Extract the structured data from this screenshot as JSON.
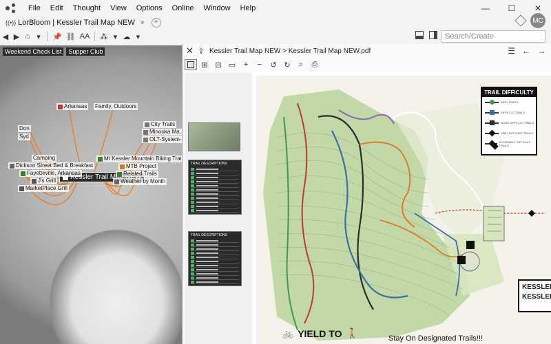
{
  "menu": {
    "items": [
      "File",
      "Edit",
      "Thought",
      "View",
      "Options",
      "Online",
      "Window",
      "Help"
    ]
  },
  "window_controls": {
    "minimize": "—",
    "maximize": "☐",
    "close": "✕"
  },
  "tab": {
    "title": "LorBloom | Kessler Trail Map NEW",
    "close": "×",
    "new_tab": "+"
  },
  "user": {
    "initials": "MC"
  },
  "toolbar": {
    "font_label": "AA"
  },
  "search": {
    "placeholder": "Search/Create"
  },
  "brain": {
    "quick_tabs": [
      "Weekend Check List",
      "Supper Club"
    ],
    "central": "Kessler Trail Map NEW",
    "thoughts": {
      "arkansas": "Arkansas",
      "family": "Family, Outdoors",
      "city_trails": "City Trails",
      "minooka": "Minooka Ma...",
      "olt": "OLT-System-...",
      "don": "Don",
      "syd": "Syd",
      "camping": "Camping",
      "dickson": "Dickson Street Bed & Breakfast",
      "fayetteville": "Fayetteville, Arkansas",
      "js_grill": "J's Grill",
      "marketplace": "MarketPlace Grill",
      "mt_kessler": "Mt Kessler Mountain Biking Trails",
      "mtb": "MTB Project",
      "related": "Related Trails",
      "weather": "Weather by Month"
    },
    "colors": {
      "link": "#f07a1e",
      "central_bg": "#2a2a2a"
    }
  },
  "document": {
    "breadcrumb": "Kessler Trail Map NEW > Kessler Trail Map NEW.pdf",
    "thumb_table_1_title": "TRAIL DESCRIPTIONS",
    "thumb_table_2_title": "TRAIL DESCRIPTIONS"
  },
  "map": {
    "legend_title": "TRAIL DIFFICULTY",
    "legend_items": [
      "EASY TRAILS",
      "DIFFICULT TRAILS",
      "MORE DIFFICULT TRAILS",
      "VERY DIFFICULT TRAILS",
      "EXTREMELY DIFFICULT TRAILS"
    ],
    "legend_colors": [
      "#3a9d4d",
      "#3b6ea8",
      "#2b2b2b",
      "#111111",
      "#111111"
    ],
    "sign_text": "KESSLER KESSLER",
    "yield_text": "YIELD TO",
    "designated_text": "Stay On Designated Trails!!!"
  }
}
